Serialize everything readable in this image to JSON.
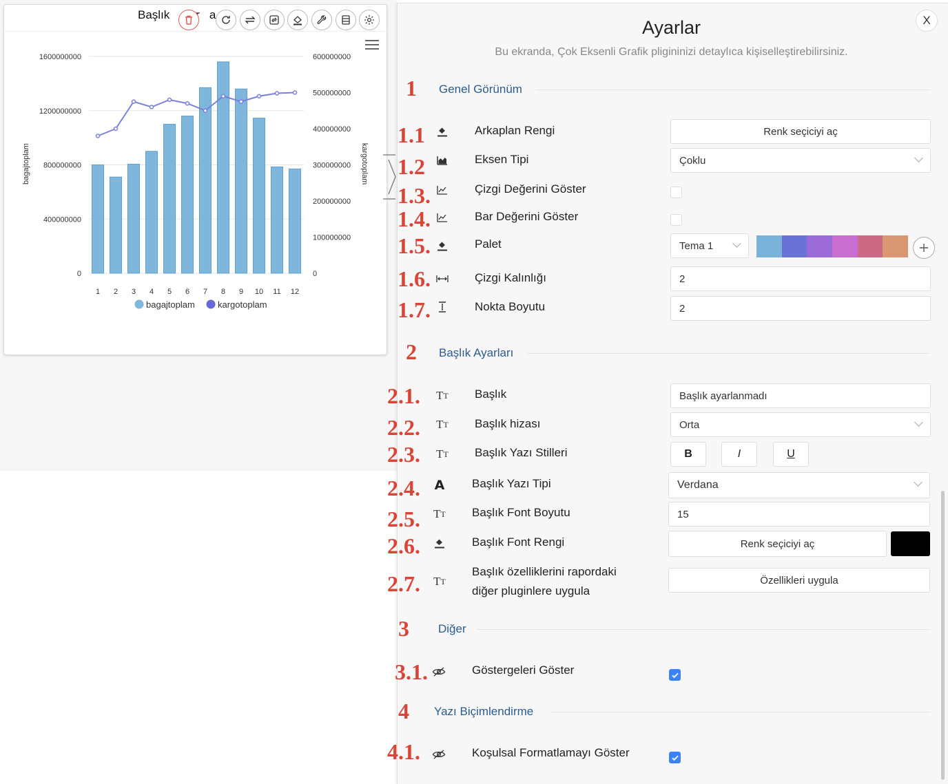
{
  "chart_card": {
    "title": "Başlık ayarlanmadı",
    "title_visible": "Başlık a  rlar  a"
  },
  "chart_data": {
    "type": "bar",
    "categories": [
      "1",
      "2",
      "3",
      "4",
      "5",
      "6",
      "7",
      "8",
      "9",
      "10",
      "11",
      "12"
    ],
    "series": [
      {
        "name": "bagajtoplam",
        "kind": "bar",
        "axis": "left",
        "color": "#7eb6dc",
        "values": [
          800000000,
          710000000,
          805000000,
          900000000,
          1100000000,
          1160000000,
          1370000000,
          1560000000,
          1360000000,
          1145000000,
          785000000,
          770000000
        ]
      },
      {
        "name": "kargotoplam",
        "kind": "line",
        "axis": "right",
        "color": "#7a7fdc",
        "values": [
          380000000,
          400000000,
          475000000,
          460000000,
          480000000,
          470000000,
          450000000,
          490000000,
          475000000,
          490000000,
          498000000,
          500000000
        ]
      }
    ],
    "y_left": {
      "label": "bagajtoplam",
      "ticks": [
        "0",
        "400000000",
        "800000000",
        "1200000000",
        "1600000000"
      ],
      "range": [
        0,
        1600000000
      ]
    },
    "y_right": {
      "label": "kargotoplam",
      "ticks": [
        "0",
        "100000000",
        "200000000",
        "300000000",
        "400000000",
        "500000000",
        "600000000"
      ],
      "range": [
        0,
        600000000
      ]
    },
    "legend": [
      {
        "name": "bagajtoplam",
        "color": "#7eb6dc"
      },
      {
        "name": "kargotoplam",
        "color": "#6568d6"
      }
    ],
    "legend_position": "bottom",
    "grid": true
  },
  "panel": {
    "title": "Ayarlar",
    "subtitle": "Bu ekranda, Çok Eksenli Grafik pligininizi detaylıca kişiselleştirebilirsiniz.",
    "close": "X"
  },
  "sections": {
    "s1": {
      "num": "1",
      "title": "Genel Görünüm"
    },
    "s2": {
      "num": "2",
      "title": "Başlık Ayarları"
    },
    "s3": {
      "num": "3",
      "title": "Diğer"
    },
    "s4": {
      "num": "4",
      "title": "Yazı Biçimlendirme"
    }
  },
  "rows": {
    "r11": {
      "num": "1.1",
      "label": "Arkaplan Rengi",
      "button": "Renk seçiciyi aç"
    },
    "r12": {
      "num": "1.2",
      "label": "Eksen Tipi",
      "value": "Çoklu"
    },
    "r13": {
      "num": "1.3.",
      "label": "Çizgi Değerini Göster",
      "checked": false
    },
    "r14": {
      "num": "1.4.",
      "label": "Bar Değerini Göster",
      "checked": false
    },
    "r15": {
      "num": "1.5.",
      "label": "Palet",
      "value": "Tema 1",
      "palette": [
        "#7bb2d9",
        "#6b72d6",
        "#9a6ad6",
        "#c86ed0",
        "#cc6a86",
        "#d99872"
      ]
    },
    "r16": {
      "num": "1.6.",
      "label": "Çizgi Kalınlığı",
      "value": "2"
    },
    "r17": {
      "num": "1.7.",
      "label": "Nokta Boyutu",
      "value": "2"
    },
    "r21": {
      "num": "2.1.",
      "label": "Başlık",
      "value": "Başlık ayarlanmadı"
    },
    "r22": {
      "num": "2.2.",
      "label": "Başlık hizası",
      "value": "Orta"
    },
    "r23": {
      "num": "2.3.",
      "label": "Başlık Yazı Stilleri",
      "bold": "B",
      "italic": "I",
      "underline": "U"
    },
    "r24": {
      "num": "2.4.",
      "label": "Başlık Yazı Tipi",
      "value": "Verdana",
      "icon_glyph": "A"
    },
    "r25": {
      "num": "2.5.",
      "label": "Başlık Font Boyutu",
      "value": "15"
    },
    "r26": {
      "num": "2.6.",
      "label": "Başlık Font Rengi",
      "button": "Renk seçiciyi aç",
      "color": "#000000"
    },
    "r27": {
      "num": "2.7.",
      "label_line1": "Başlık özelliklerini rapordaki",
      "label_line2": "diğer pluginlere uygula",
      "button": "Özellikleri uygula"
    },
    "r31": {
      "num": "3.1.",
      "label": "Göstergeleri Göster",
      "checked": true
    },
    "r41": {
      "num": "4.1.",
      "label": "Koşulsal Formatlamayı Göster",
      "checked": true
    }
  }
}
